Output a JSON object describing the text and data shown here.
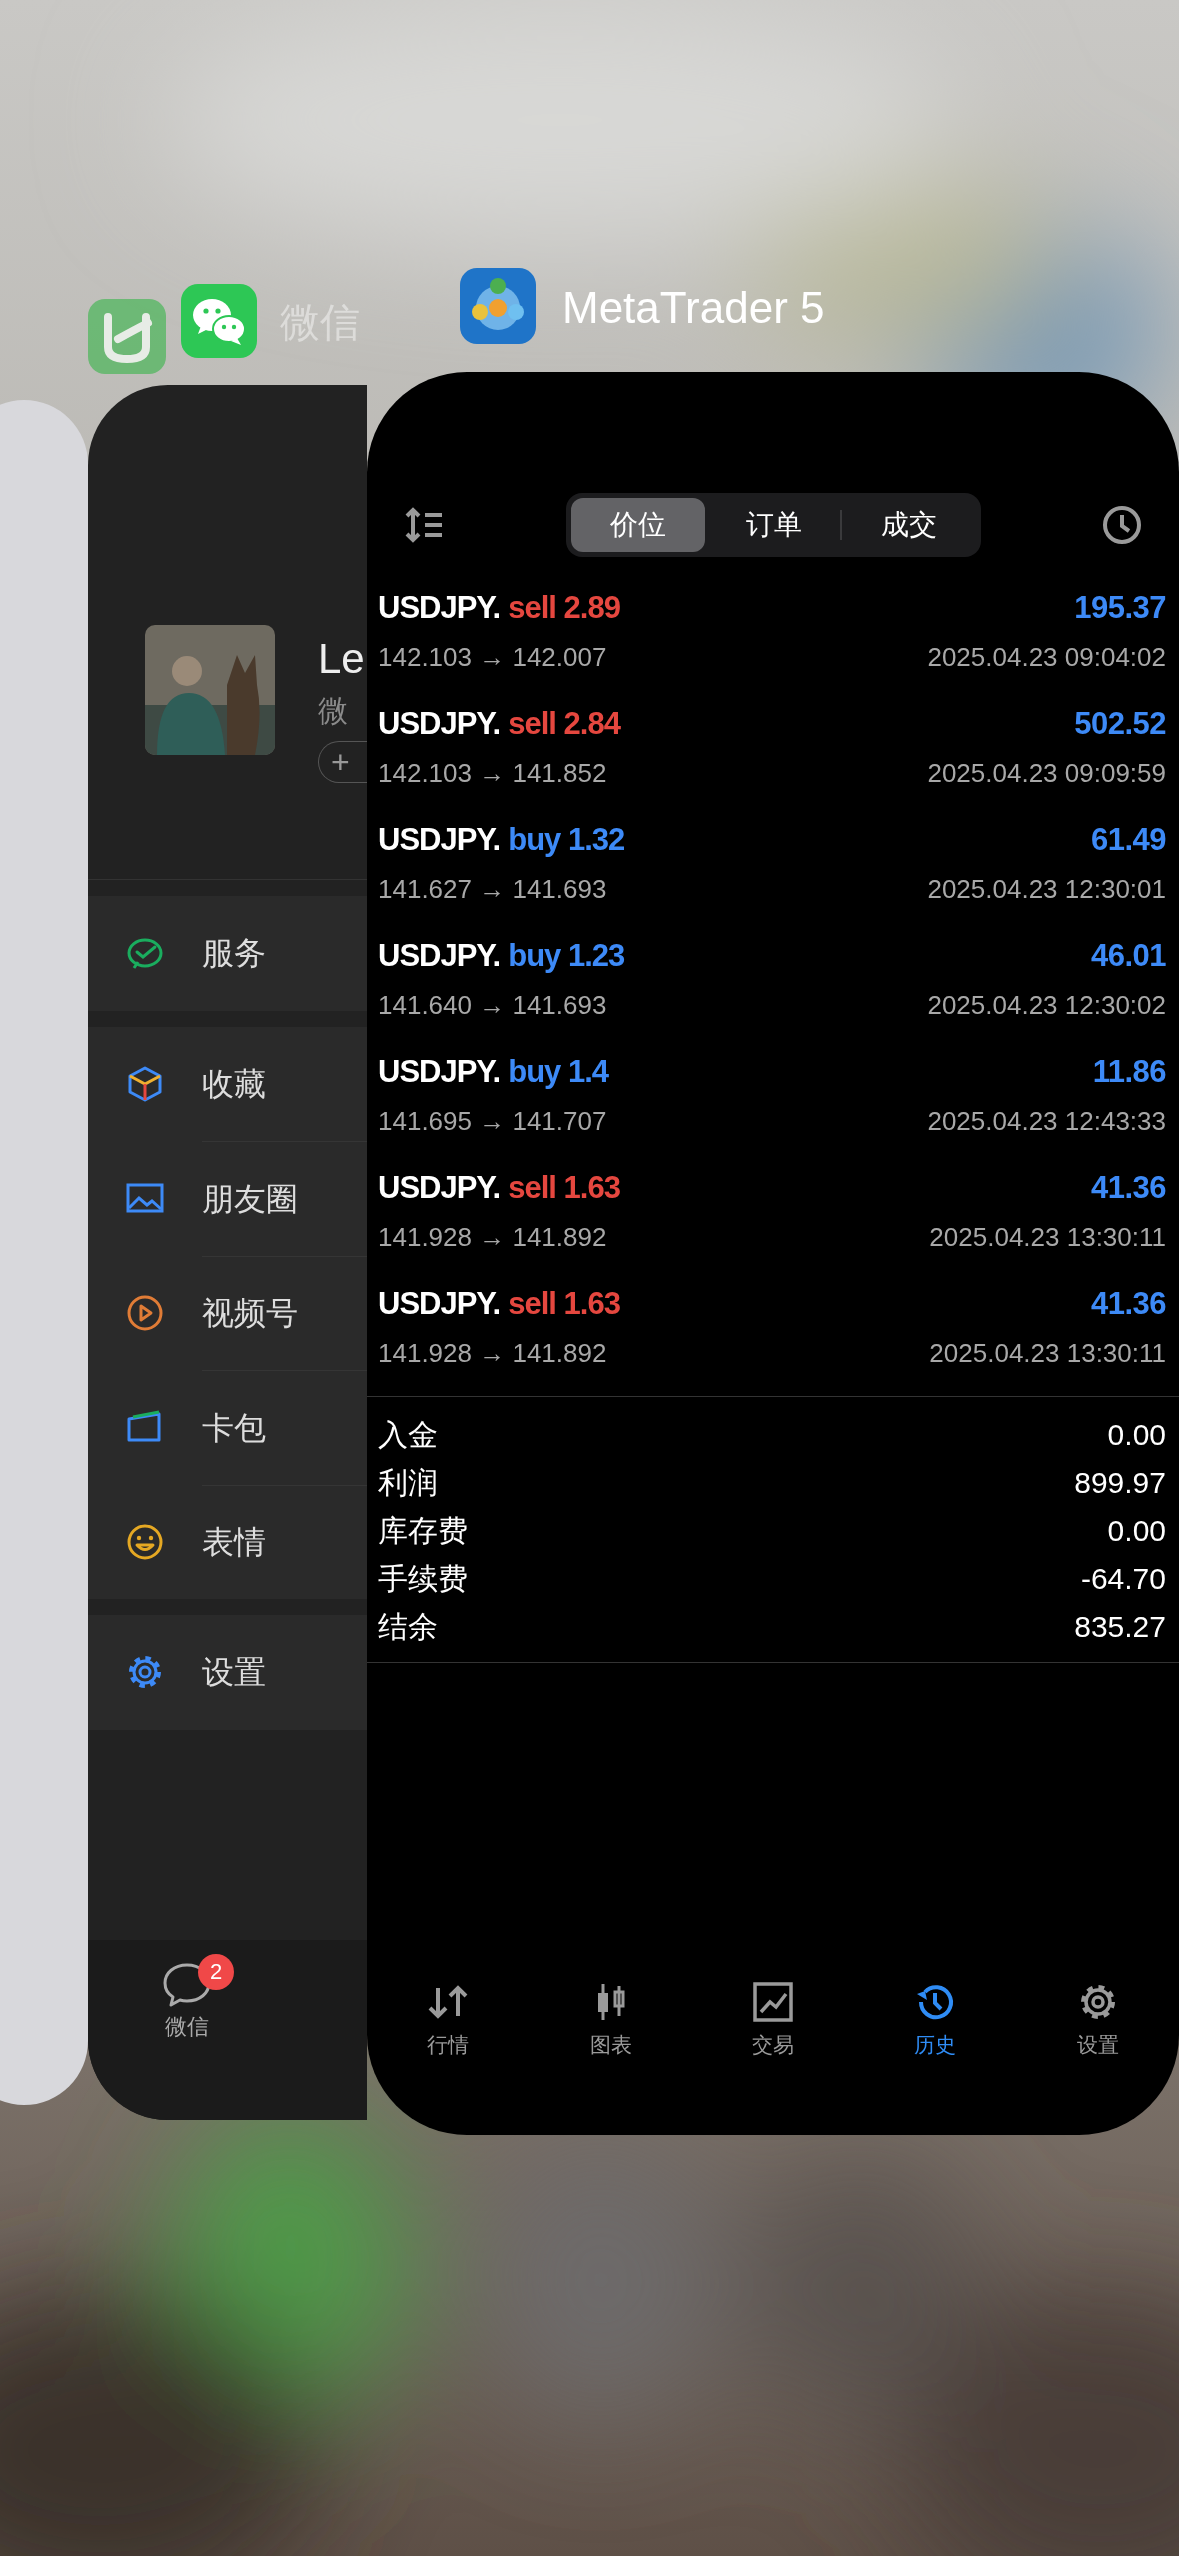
{
  "switcher": {
    "back_app_label": {
      "title": "微信"
    },
    "front_app_label": {
      "title": "MetaTrader 5"
    }
  },
  "wechat": {
    "profile": {
      "name": "Le",
      "subtitle": "微",
      "status_button": "+"
    },
    "menu_groups": [
      {
        "items": [
          {
            "label": "服务"
          }
        ]
      },
      {
        "items": [
          {
            "label": "收藏"
          },
          {
            "label": "朋友圈"
          },
          {
            "label": "视频号"
          },
          {
            "label": "卡包"
          },
          {
            "label": "表情"
          }
        ]
      },
      {
        "items": [
          {
            "label": "设置"
          }
        ]
      }
    ],
    "tab_bar": [
      {
        "label": "微信",
        "badge": "2"
      }
    ]
  },
  "metatrader": {
    "segments": [
      {
        "label": "价位",
        "selected": true
      },
      {
        "label": "订单",
        "selected": false
      },
      {
        "label": "成交",
        "selected": false
      }
    ],
    "deals": [
      {
        "symbol": "USDJPY.",
        "order": "sell 2.89",
        "kind": "sell",
        "profit": "195.37",
        "prices": "142.103 → 142.007",
        "time": "2025.04.23 09:04:02"
      },
      {
        "symbol": "USDJPY.",
        "order": "sell 2.84",
        "kind": "sell",
        "profit": "502.52",
        "prices": "142.103 → 141.852",
        "time": "2025.04.23 09:09:59"
      },
      {
        "symbol": "USDJPY.",
        "order": "buy 1.32",
        "kind": "buy",
        "profit": "61.49",
        "prices": "141.627 → 141.693",
        "time": "2025.04.23 12:30:01"
      },
      {
        "symbol": "USDJPY.",
        "order": "buy 1.23",
        "kind": "buy",
        "profit": "46.01",
        "prices": "141.640 → 141.693",
        "time": "2025.04.23 12:30:02"
      },
      {
        "symbol": "USDJPY.",
        "order": "buy 1.4",
        "kind": "buy",
        "profit": "11.86",
        "prices": "141.695 → 141.707",
        "time": "2025.04.23 12:43:33"
      },
      {
        "symbol": "USDJPY.",
        "order": "sell 1.63",
        "kind": "sell",
        "profit": "41.36",
        "prices": "141.928 → 141.892",
        "time": "2025.04.23 13:30:11"
      },
      {
        "symbol": "USDJPY.",
        "order": "sell 1.63",
        "kind": "sell",
        "profit": "41.36",
        "prices": "141.928 → 141.892",
        "time": "2025.04.23 13:30:11"
      }
    ],
    "summary": [
      {
        "label": "入金",
        "value": "0.00"
      },
      {
        "label": "利润",
        "value": "899.97"
      },
      {
        "label": "库存费",
        "value": "0.00"
      },
      {
        "label": "手续费",
        "value": "-64.70"
      },
      {
        "label": "结余",
        "value": "835.27"
      }
    ],
    "bottom_nav": [
      {
        "label": "行情",
        "selected": false
      },
      {
        "label": "图表",
        "selected": false
      },
      {
        "label": "交易",
        "selected": false
      },
      {
        "label": "历史",
        "selected": true
      },
      {
        "label": "设置",
        "selected": false
      }
    ]
  }
}
